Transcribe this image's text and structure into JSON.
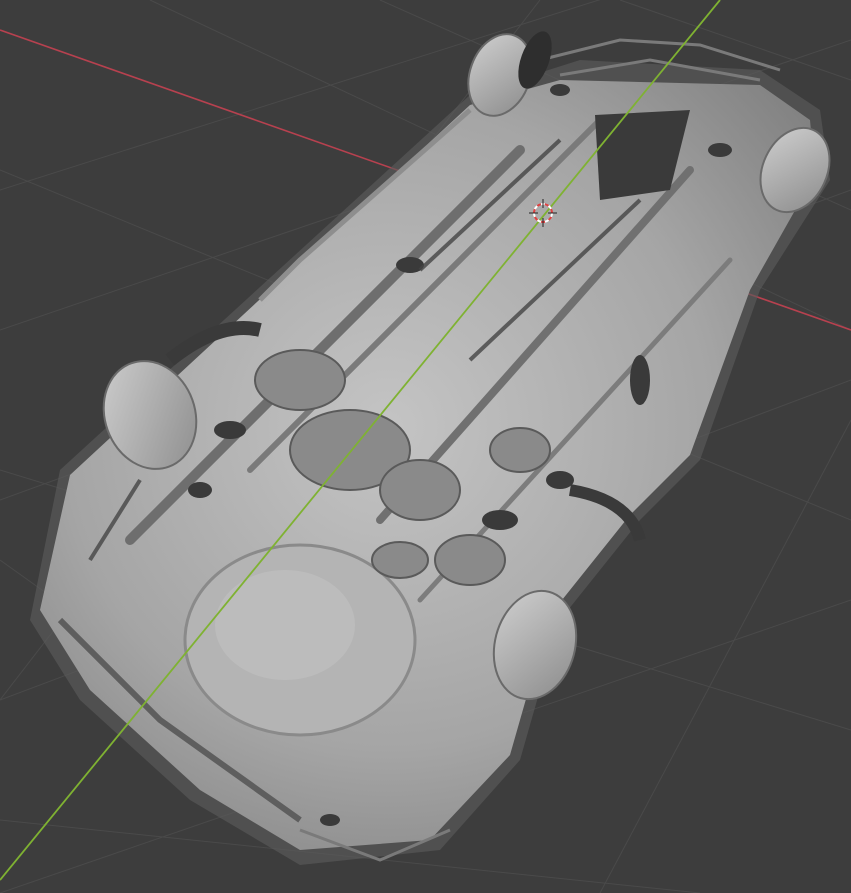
{
  "viewport": {
    "background_color": "#3d3d3d",
    "grid_color": "#4d4d4d",
    "x_axis_color": "#b7414f",
    "y_axis_color": "#7fb232",
    "mesh_color": "#a8a8a8",
    "mesh_shadow_color": "#5a5a5a",
    "cursor_colors": [
      "#e04040",
      "#ffffff"
    ],
    "icon": "3d-cursor-icon"
  }
}
